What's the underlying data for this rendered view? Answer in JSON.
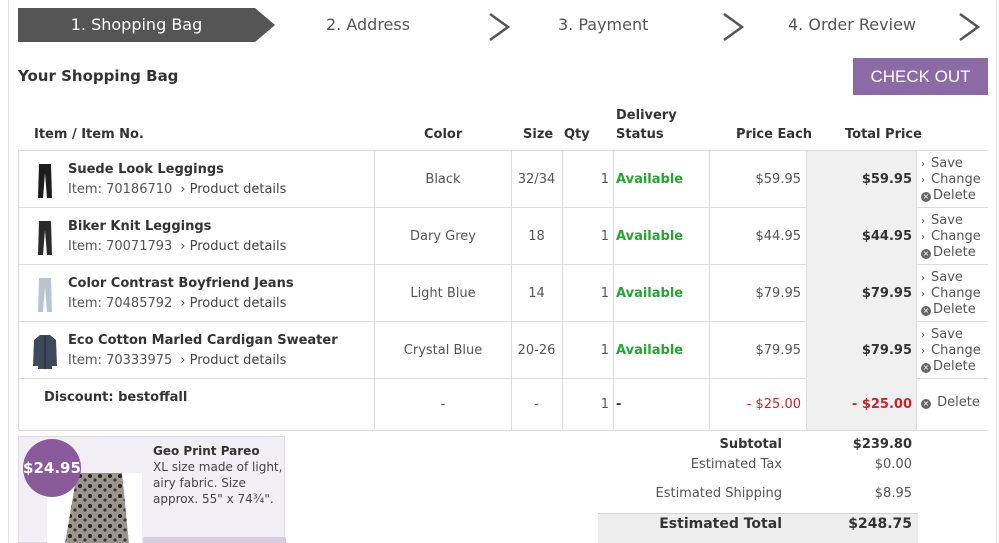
{
  "steps": [
    {
      "label": "1. Shopping Bag"
    },
    {
      "label": "2. Address"
    },
    {
      "label": "3. Payment"
    },
    {
      "label": "4. Order Review"
    }
  ],
  "bag_title": "Your Shopping Bag",
  "checkout_label": "CHECK OUT",
  "columns": {
    "item": "Item / Item No.",
    "color": "Color",
    "size": "Size",
    "qty": "Qty",
    "delivery": "Delivery",
    "status": "Status",
    "price_each": "Price Each",
    "total_price": "Total Price"
  },
  "items": [
    {
      "name": "Suede Look Leggings",
      "item_no": "Item: 70186710",
      "details_link": "Product details",
      "color": "Black",
      "size": "32/34",
      "qty": "1",
      "status": "Available",
      "price_each": "$59.95",
      "total": "$59.95",
      "thumb_color": "#1c1c1c"
    },
    {
      "name": "Biker Knit Leggings",
      "item_no": "Item: 70071793",
      "details_link": "Product details",
      "color": "Dary Grey",
      "size": "18",
      "qty": "1",
      "status": "Available",
      "price_each": "$44.95",
      "total": "$44.95",
      "thumb_color": "#2a2a2a"
    },
    {
      "name": "Color Contrast Boyfriend Jeans",
      "item_no": "Item: 70485792",
      "details_link": "Product details",
      "color": "Light Blue",
      "size": "14",
      "qty": "1",
      "status": "Available",
      "price_each": "$79.95",
      "total": "$79.95",
      "thumb_color": "#b9c4d3"
    },
    {
      "name": "Eco Cotton Marled Cardigan Sweater",
      "item_no": "Item: 70333975",
      "details_link": "Product details",
      "color": "Crystal Blue",
      "size": "20-26",
      "qty": "1",
      "status": "Available",
      "price_each": "$79.95",
      "total": "$79.95",
      "thumb_color": "#3e4a5c"
    }
  ],
  "actions": {
    "save": "Save",
    "change": "Change",
    "delete": "Delete"
  },
  "discount": {
    "label": "Discount: bestoffall",
    "color": "-",
    "size": "-",
    "qty": "1",
    "status": "-",
    "price_each": "- $25.00",
    "total": "- $25.00",
    "delete": "Delete"
  },
  "promo": {
    "badge": "$24.95",
    "title": "Geo Print Pareo",
    "description": "XL size made of light, airy fabric. Size approx. 55\" x 74¾\"."
  },
  "totals": {
    "subtotal_label": "Subtotal",
    "subtotal_value": "$239.80",
    "tax_label": "Estimated Tax",
    "tax_value": "$0.00",
    "shipping_label": "Estimated Shipping",
    "shipping_value": "$8.95",
    "total_label": "Estimated Total",
    "total_value": "$248.75"
  },
  "colors": {
    "accent": "#8b6aa6",
    "available": "#2aa336",
    "discount_red": "#c0282d",
    "active_step": "#555555"
  }
}
